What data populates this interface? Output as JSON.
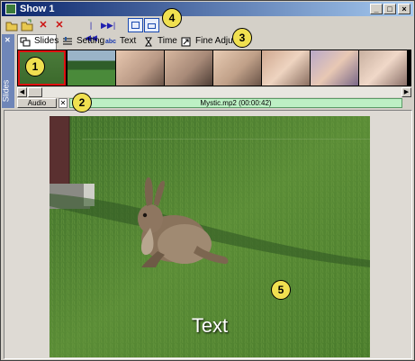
{
  "window": {
    "title": "Show 1"
  },
  "callouts": [
    "1",
    "2",
    "3",
    "4",
    "5"
  ],
  "sidebar": {
    "label": "Slides"
  },
  "tabs": [
    {
      "label": "Slides",
      "icon": "slides-icon"
    },
    {
      "label": "Setting",
      "icon": "setting-icon"
    },
    {
      "label": "Text",
      "icon": "text-icon",
      "icon_text": "abc"
    },
    {
      "label": "Time",
      "icon": "hourglass-icon"
    },
    {
      "label": "Fine Adjust",
      "icon": "fine-adjust-icon"
    }
  ],
  "audio": {
    "label": "Audio",
    "track": "Mystic.mp2 (00:00:42)"
  },
  "preview": {
    "overlay_text": "Text"
  },
  "colors": {
    "title_gradient_start": "#0a246a",
    "selection_border": "#e01010",
    "audio_track": "#bdf0c4",
    "callout": "#f0e050"
  }
}
